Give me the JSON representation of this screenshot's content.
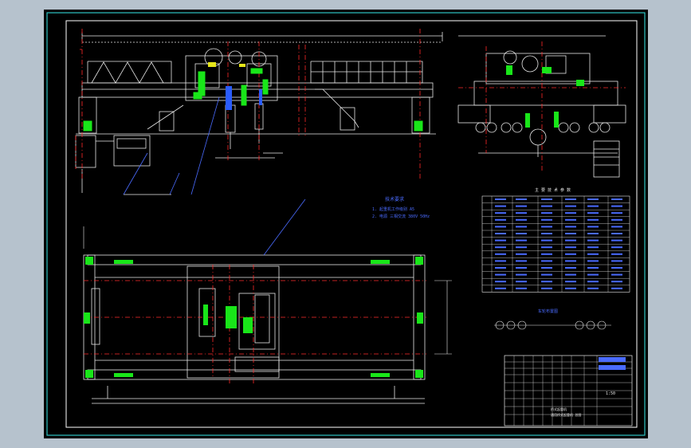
{
  "colors": {
    "background": "#000000",
    "outer_frame": "#2ec4c4",
    "inner_frame": "#ffffff",
    "line_white": "#e8e8e8",
    "centerline_red": "#ff2a2a",
    "component_green": "#19e619",
    "note_blue": "#4a6bff",
    "fill_yellow": "#e6e61a",
    "shaft_blue": "#2a5cff"
  },
  "notes": {
    "heading": "技术要求",
    "line1": "1. 起重机工作级别 A5",
    "line2": "2. 电源 三相交流 380V 50Hz"
  },
  "parameter_table": {
    "title": "主 要 技 术 参 数"
  },
  "wheel_diagram": {
    "title": "车轮布置图"
  },
  "title_block": {
    "name": "桥式起重机",
    "subtitle": "通用桥式起重机 总图",
    "sheet": "1:50"
  }
}
